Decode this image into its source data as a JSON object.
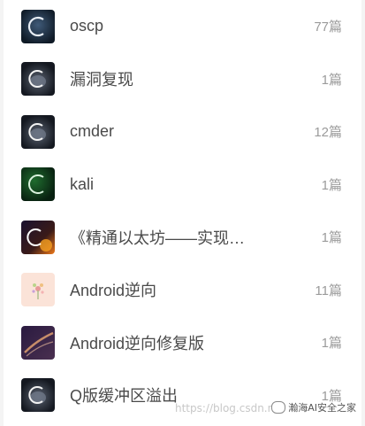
{
  "columns": [
    {
      "title": "oscp",
      "count": "77篇",
      "icon": "dark-c-logo-icon",
      "theme": "blue"
    },
    {
      "title": "漏洞复现",
      "count": "1篇",
      "icon": "planet-c-logo-icon",
      "theme": "planet"
    },
    {
      "title": "cmder",
      "count": "12篇",
      "icon": "planet-c-logo-icon",
      "theme": "planet"
    },
    {
      "title": "kali",
      "count": "1篇",
      "icon": "green-c-logo-icon",
      "theme": "green"
    },
    {
      "title": "《精通以太坊——实现…",
      "count": "1篇",
      "icon": "fire-c-logo-icon",
      "theme": "fire"
    },
    {
      "title": "Android逆向",
      "count": "11篇",
      "icon": "flower-thumbnail-icon",
      "theme": "flower"
    },
    {
      "title": "Android逆向修复版",
      "count": "1篇",
      "icon": "purple-streak-thumbnail-icon",
      "theme": "purple"
    },
    {
      "title": "Q版缓冲区溢出",
      "count": "1篇",
      "icon": "planet-c-logo-icon",
      "theme": "planet"
    }
  ],
  "watermark": "https://blog.csdn.n",
  "brand": "瀚海AI安全之家"
}
